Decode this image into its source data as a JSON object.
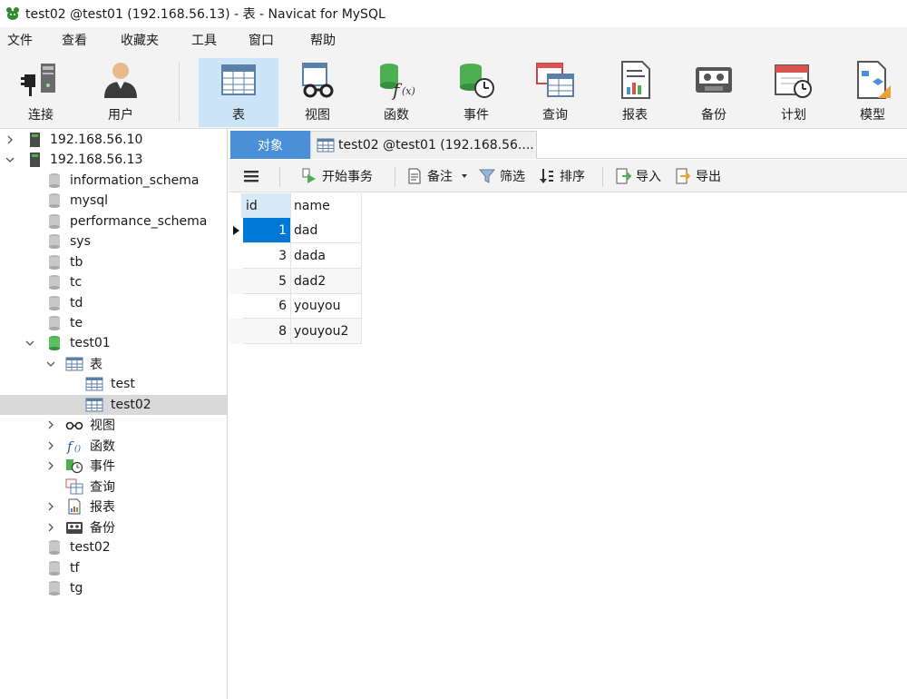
{
  "window": {
    "title": "test02 @test01 (192.168.56.13) - 表 - Navicat for MySQL"
  },
  "menu": [
    "文件",
    "查看",
    "收藏夹",
    "工具",
    "窗口",
    "帮助"
  ],
  "ribbon": {
    "connect": "连接",
    "user": "用户",
    "table": "表",
    "view": "视图",
    "function": "函数",
    "event": "事件",
    "query": "查询",
    "report": "报表",
    "backup": "备份",
    "schedule": "计划",
    "model": "模型"
  },
  "tree": {
    "conn1": "192.168.56.10",
    "conn2": "192.168.56.13",
    "dbs_before": [
      "information_schema",
      "mysql",
      "performance_schema",
      "sys",
      "tb",
      "tc",
      "td",
      "te"
    ],
    "open_db": "test01",
    "tables_group": "表",
    "tables": [
      "test",
      "test02"
    ],
    "groups": [
      "视图",
      "函数",
      "事件",
      "查询",
      "报表",
      "备份"
    ],
    "dbs_after": [
      "test02",
      "tf",
      "tg"
    ]
  },
  "tabs": {
    "objects": "对象",
    "table_tab": "test02 @test01 (192.168.56...."
  },
  "toolbar": {
    "begin_tx": "开始事务",
    "memo": "备注",
    "filter": "筛选",
    "sort": "排序",
    "import": "导入",
    "export": "导出"
  },
  "grid": {
    "columns": [
      "id",
      "name"
    ],
    "rows": [
      {
        "id": "1",
        "name": "dad"
      },
      {
        "id": "3",
        "name": "dada"
      },
      {
        "id": "5",
        "name": "dad2"
      },
      {
        "id": "6",
        "name": "youyou"
      },
      {
        "id": "8",
        "name": "youyou2"
      }
    ]
  },
  "colors": {
    "accent": "#4a90d9",
    "selected_cell": "#0078d7",
    "ribbon_active": "#cce4f7"
  }
}
